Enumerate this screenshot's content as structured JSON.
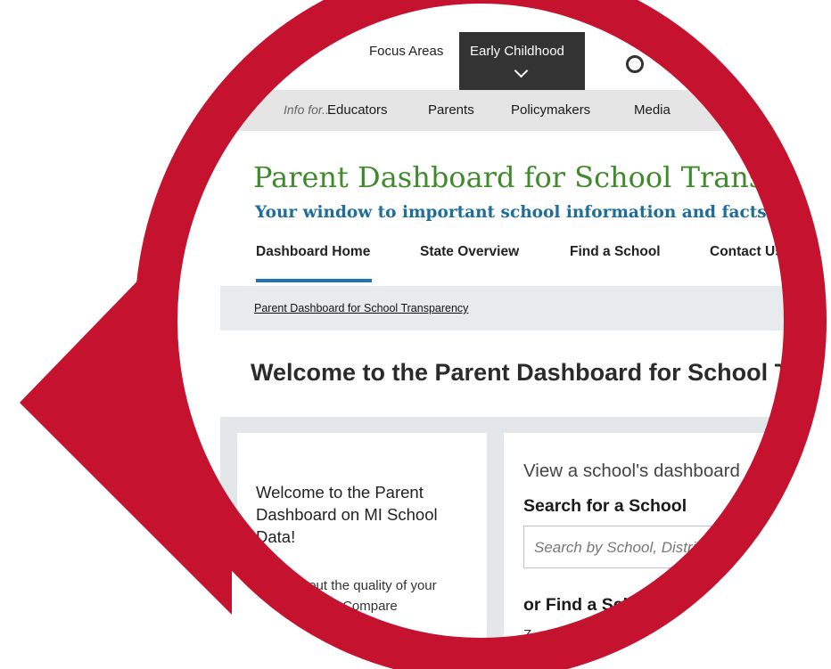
{
  "colors": {
    "ring_red": "#c4122f",
    "title_green": "#3f8a2a",
    "subtitle_blue": "#1e6d9a",
    "tab_active_blue": "#1f75b4",
    "top_dark": "#333333"
  },
  "topnav": {
    "focus_areas": "Focus Areas",
    "early_childhood": "Early Childhood",
    "chevron_icon": "chevron-down-icon",
    "search_icon": "search-icon"
  },
  "audience_bar": {
    "intro": "Info for...",
    "items": [
      "Educators",
      "Parents",
      "Policymakers",
      "Media"
    ]
  },
  "header": {
    "title": "Parent Dashboard for School Transparency",
    "subtitle": "Your window to important school information and facts"
  },
  "tabs": [
    {
      "label": "Dashboard Home",
      "active": true
    },
    {
      "label": "State Overview",
      "active": false
    },
    {
      "label": "Find a School",
      "active": false
    },
    {
      "label": "Contact Us",
      "active": false
    }
  ],
  "breadcrumb": {
    "link": "Parent Dashboard for School Transparency"
  },
  "main": {
    "heading": "Welcome to the Parent Dashboard for School Transparency"
  },
  "left_card": {
    "intro": "Welcome to the Parent Dashboard on MI School Data!",
    "body": "Learn about the quality of your child's school. Compare"
  },
  "right_card": {
    "view_text": "View a school's dashboard",
    "search_heading": "Search for a School",
    "search_placeholder": "Search by School, District",
    "find_heading": "or Find a School",
    "zip_label": "Z"
  }
}
